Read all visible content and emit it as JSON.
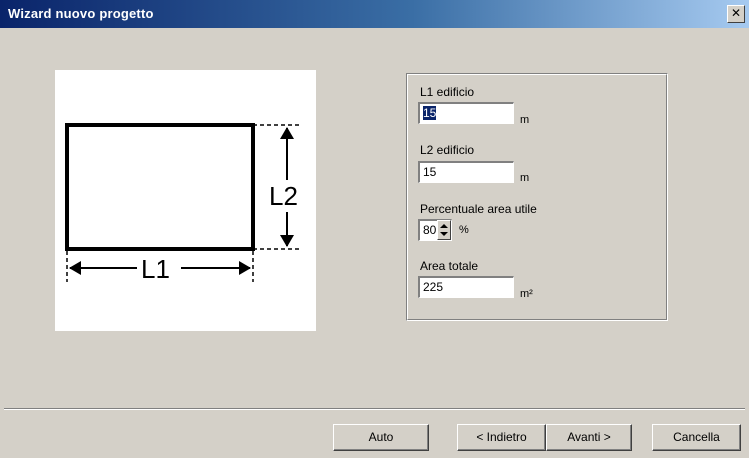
{
  "window": {
    "title": "Wizard nuovo progetto",
    "close_label": "✕"
  },
  "diagram": {
    "label_l1": "L1",
    "label_l2": "L2"
  },
  "form": {
    "l1": {
      "label": "L1 edificio",
      "value": "15",
      "unit": "m"
    },
    "l2": {
      "label": "L2 edificio",
      "value": "15",
      "unit": "m"
    },
    "percent": {
      "label": "Percentuale area utile",
      "value": "80",
      "unit": "%"
    },
    "area": {
      "label": "Area totale",
      "value": "225",
      "unit": "m²"
    }
  },
  "buttons": {
    "auto": "Auto",
    "back": "< Indietro",
    "next": "Avanti >",
    "cancel": "Cancella"
  }
}
